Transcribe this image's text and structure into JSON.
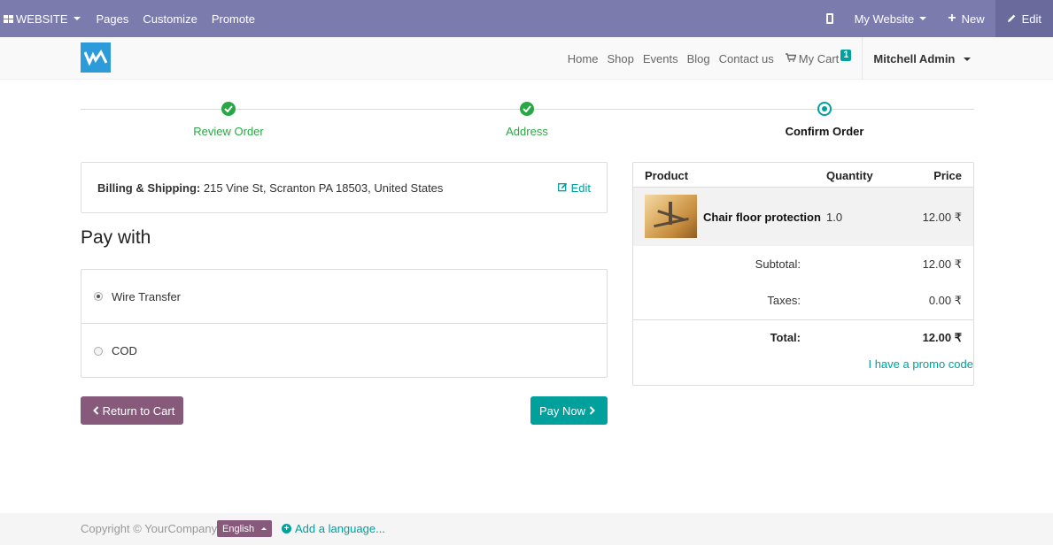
{
  "admin_bar": {
    "website_label": "WEBSITE",
    "pages": "Pages",
    "customize": "Customize",
    "promote": "Promote",
    "my_website": "My Website",
    "new": "New",
    "edit": "Edit"
  },
  "nav": {
    "home": "Home",
    "shop": "Shop",
    "events": "Events",
    "blog": "Blog",
    "contact": "Contact us",
    "cart": "My Cart",
    "cart_count": "1",
    "user": "Mitchell Admin"
  },
  "wizard": {
    "steps": [
      {
        "label": "Review Order",
        "state": "done"
      },
      {
        "label": "Address",
        "state": "done"
      },
      {
        "label": "Confirm Order",
        "state": "current"
      }
    ]
  },
  "billing": {
    "label": "Billing & Shipping:",
    "address": " 215 Vine St, Scranton PA 18503, United States",
    "edit": "Edit"
  },
  "payment": {
    "heading": "Pay with",
    "options": [
      {
        "label": "Wire Transfer",
        "checked": true
      },
      {
        "label": "COD",
        "checked": false
      }
    ],
    "return_label": "Return to Cart",
    "paynow_label": "Pay Now"
  },
  "summary": {
    "headers": {
      "product": "Product",
      "quantity": "Quantity",
      "price": "Price"
    },
    "items": [
      {
        "name": "Chair floor protection",
        "quantity": "1.0",
        "price": "12.00 ₹"
      }
    ],
    "subtotal_label": "Subtotal:",
    "subtotal": "12.00 ₹",
    "taxes_label": "Taxes:",
    "taxes": "0.00 ₹",
    "total_label": "Total:",
    "total": "12.00 ₹",
    "promo": "I have a promo code"
  },
  "footer": {
    "copyright": "Copyright © YourCompany",
    "language": "English",
    "add_language": "Add a language..."
  },
  "colors": {
    "admin_bar": "#7c7bad",
    "primary": "#00a09d",
    "secondary": "#875a7b",
    "success": "#28a745",
    "logo": "#2d9ad9"
  }
}
